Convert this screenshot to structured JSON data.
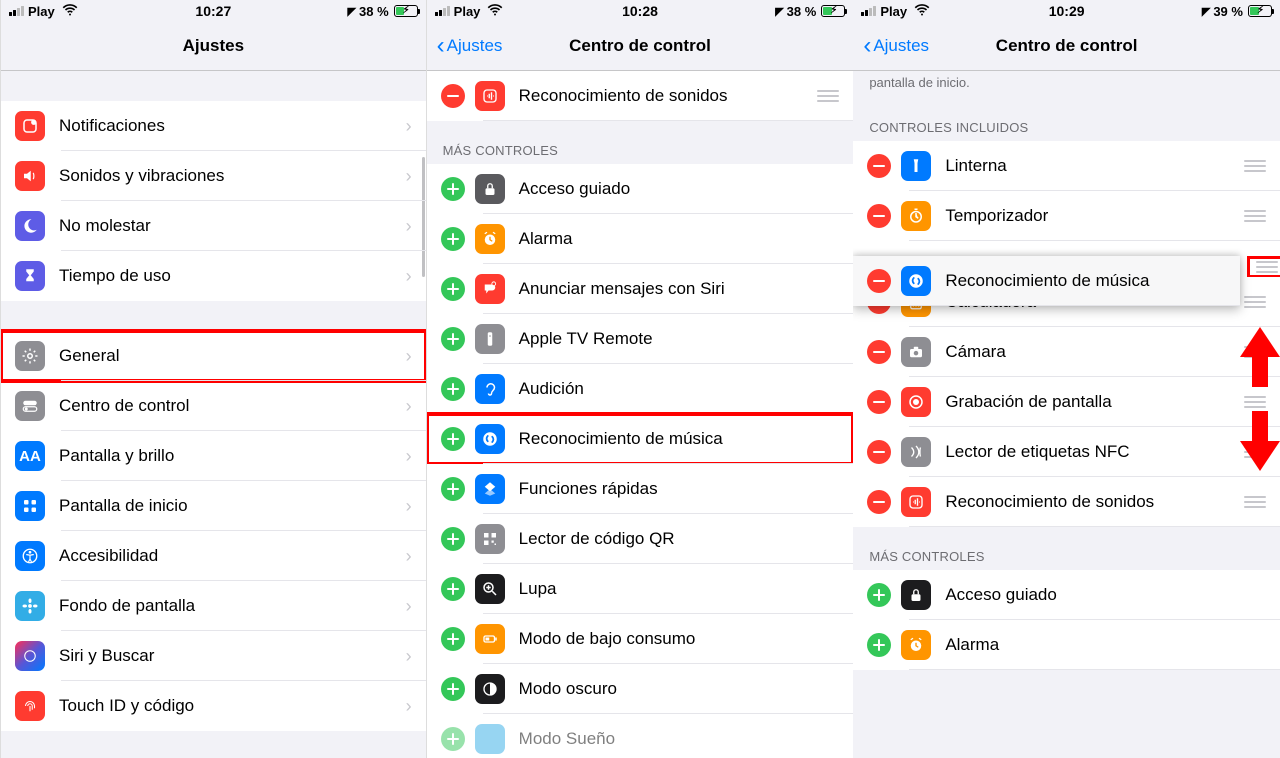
{
  "screen1": {
    "status": {
      "carrier": "Play",
      "time": "10:27",
      "battery": "38 %"
    },
    "title": "Ajustes",
    "group1": [
      {
        "label": "Notificaciones",
        "icon_bg": "ic-red"
      },
      {
        "label": "Sonidos y vibraciones",
        "icon_bg": "ic-red"
      },
      {
        "label": "No molestar",
        "icon_bg": "ic-indigo"
      },
      {
        "label": "Tiempo de uso",
        "icon_bg": "ic-indigo"
      }
    ],
    "group2": [
      {
        "label": "General",
        "icon_bg": "ic-gray",
        "highlight": true
      },
      {
        "label": "Centro de control",
        "icon_bg": "ic-gray"
      },
      {
        "label": "Pantalla y brillo",
        "icon_bg": "ic-blue"
      },
      {
        "label": "Pantalla de inicio",
        "icon_bg": "ic-blue"
      },
      {
        "label": "Accesibilidad",
        "icon_bg": "ic-blue"
      },
      {
        "label": "Fondo de pantalla",
        "icon_bg": "ic-cyan"
      },
      {
        "label": "Siri y Buscar",
        "icon_bg": "ic-black"
      },
      {
        "label": "Touch ID y código",
        "icon_bg": "ic-red"
      }
    ]
  },
  "screen2": {
    "status": {
      "carrier": "Play",
      "time": "10:28",
      "battery": "38 %"
    },
    "back": "Ajustes",
    "title": "Centro de control",
    "top_item": {
      "label": "Reconocimiento de sonidos"
    },
    "more_header": "MÁS CONTROLES",
    "more": [
      {
        "label": "Acceso guiado",
        "icon_bg": "ic-darkgray"
      },
      {
        "label": "Alarma",
        "icon_bg": "ic-orange"
      },
      {
        "label": "Anunciar mensajes con Siri",
        "icon_bg": "ic-red"
      },
      {
        "label": "Apple TV Remote",
        "icon_bg": "ic-gray"
      },
      {
        "label": "Audición",
        "icon_bg": "ic-blue"
      },
      {
        "label": "Reconocimiento de música",
        "icon_bg": "ic-blue",
        "highlight": true
      },
      {
        "label": "Funciones rápidas",
        "icon_bg": "ic-blue"
      },
      {
        "label": "Lector de código QR",
        "icon_bg": "ic-gray"
      },
      {
        "label": "Lupa",
        "icon_bg": "ic-black"
      },
      {
        "label": "Modo de bajo consumo",
        "icon_bg": "ic-orange"
      },
      {
        "label": "Modo oscuro",
        "icon_bg": "ic-black"
      },
      {
        "label": "Modo Sueño",
        "icon_bg": "ic-cyan"
      }
    ]
  },
  "screen3": {
    "status": {
      "carrier": "Play",
      "time": "10:29",
      "battery": "39 %"
    },
    "back": "Ajustes",
    "title": "Centro de control",
    "subtext": "pantalla de inicio.",
    "included_header": "CONTROLES INCLUIDOS",
    "included": [
      {
        "label": "Linterna",
        "icon_bg": "ic-blue"
      },
      {
        "label": "Temporizador",
        "icon_bg": "ic-orange"
      },
      {
        "label": "Reconocimiento de música",
        "icon_bg": "ic-blue",
        "float": true
      },
      {
        "label": "Calculadora",
        "icon_bg": "ic-orange"
      },
      {
        "label": "Cámara",
        "icon_bg": "ic-gray"
      },
      {
        "label": "Grabación de pantalla",
        "icon_bg": "ic-red"
      },
      {
        "label": "Lector de etiquetas NFC",
        "icon_bg": "ic-gray"
      },
      {
        "label": "Reconocimiento de sonidos",
        "icon_bg": "ic-red"
      }
    ],
    "more_header": "MÁS CONTROLES",
    "more": [
      {
        "label": "Acceso guiado",
        "icon_bg": "ic-black"
      },
      {
        "label": "Alarma",
        "icon_bg": "ic-orange"
      }
    ]
  }
}
